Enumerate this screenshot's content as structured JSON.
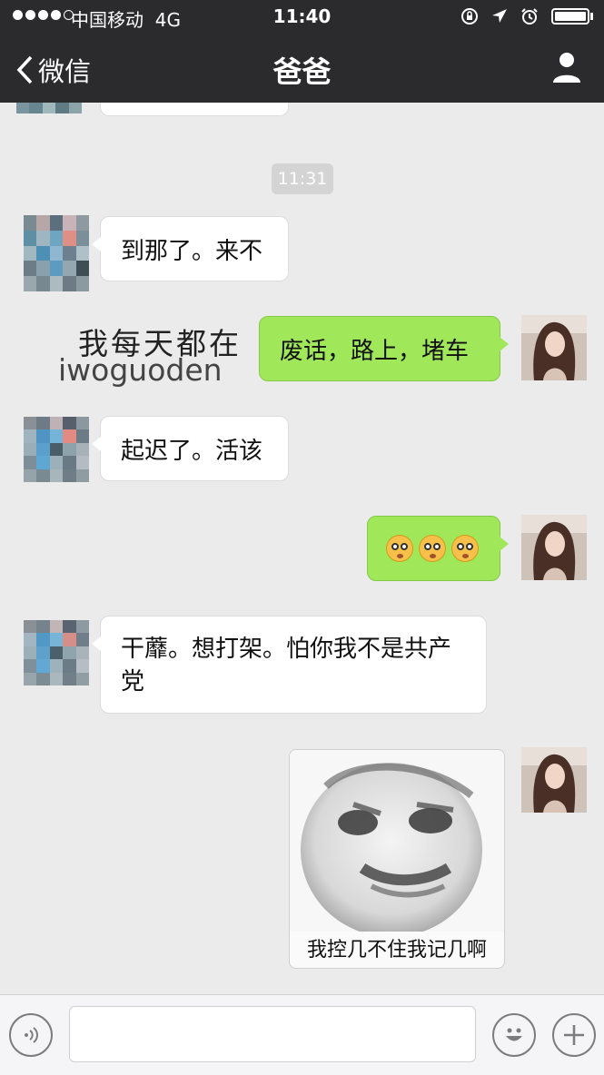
{
  "status_bar": {
    "carrier": "中国移动",
    "network": "4G",
    "time": "11:40",
    "icons": [
      "lock-rotation-icon",
      "location-arrow-icon",
      "alarm-icon",
      "battery-icon"
    ]
  },
  "nav": {
    "back_label": "微信",
    "title": "爸爸",
    "profile_icon": "person-icon"
  },
  "chat": {
    "timestamp": "11:31",
    "messages": [
      {
        "side": "in",
        "type": "text",
        "text": "到那了。来不"
      },
      {
        "side": "out",
        "type": "text",
        "text": "废话，路上，堵车"
      },
      {
        "side": "in",
        "type": "text",
        "text": "起迟了。活该"
      },
      {
        "side": "out",
        "type": "emoji",
        "emojis": [
          "astonished-face-icon",
          "astonished-face-icon",
          "astonished-face-icon"
        ]
      },
      {
        "side": "in",
        "type": "text",
        "text": "干蘼。想打架。怕你我不是共产党"
      },
      {
        "side": "out",
        "type": "sticker",
        "caption": "我控几不住我记几啊"
      }
    ],
    "watermark": {
      "line1": "我每天都在",
      "line2": "iwoguoden"
    }
  },
  "input_bar": {
    "left_icon": "voice-icon",
    "emoji_icon": "smiley-icon",
    "plus_icon": "plus-icon"
  },
  "colors": {
    "topbar": "#2b2b2e",
    "chat_bg": "#ebebeb",
    "bubble_out": "#a0e75a",
    "bubble_in": "#ffffff"
  }
}
